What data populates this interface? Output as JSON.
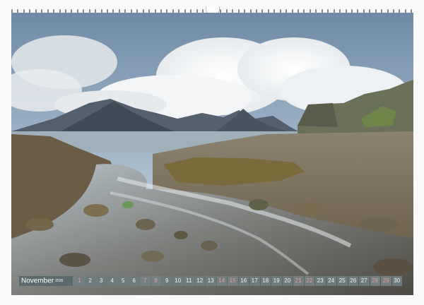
{
  "calendar": {
    "month": "November",
    "year": "2026",
    "days": [
      "1",
      "2",
      "3",
      "4",
      "5",
      "6",
      "7",
      "8",
      "9",
      "10",
      "11",
      "12",
      "13",
      "14",
      "15",
      "16",
      "17",
      "18",
      "19",
      "20",
      "21",
      "22",
      "23",
      "24",
      "25",
      "26",
      "27",
      "28",
      "29",
      "30"
    ],
    "weekend_days": [
      "1",
      "7",
      "8",
      "14",
      "15",
      "21",
      "22",
      "28",
      "29"
    ]
  },
  "colors": {
    "bar_background": "#5b6a6c",
    "day_text": "#f2f2f2",
    "weekend_text": "#e4a0a0"
  }
}
